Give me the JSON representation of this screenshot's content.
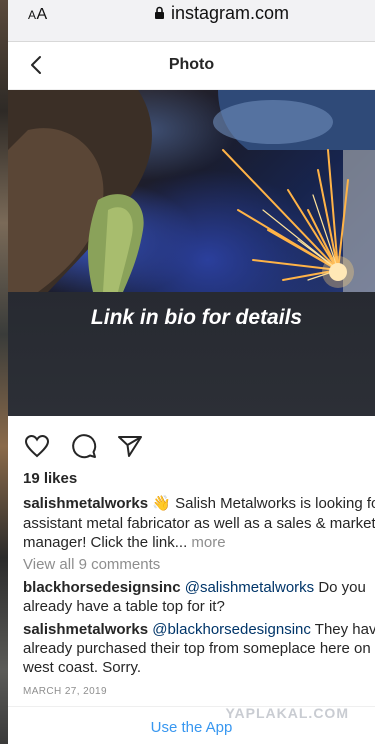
{
  "browser": {
    "text_size_label": "AA",
    "domain": "instagram.com"
  },
  "header": {
    "title": "Photo"
  },
  "photo": {
    "overlay_text": "Link in bio for details"
  },
  "post": {
    "likes": "19 likes",
    "caption": {
      "author": "salishmetalworks",
      "emoji": "👋",
      "line1": "Salish Metalworks is looking fo",
      "line2": "assistant metal fabricator as well as a sales & market",
      "line3": "manager! Click the link...",
      "more": "more"
    },
    "view_all_comments": "View all 9 comments",
    "comments": [
      {
        "author": "blackhorsedesignsinc",
        "mention": "@salishmetalworks",
        "line1": "Do you",
        "line2": "already have a table top for it?"
      },
      {
        "author": "salishmetalworks",
        "mention": "@blackhorsedesignsinc",
        "line1": "They have",
        "line2": "already purchased their top from someplace here on",
        "line3": "west coast. Sorry."
      }
    ],
    "date": "MARCH 27, 2019"
  },
  "footer": {
    "use_app": "Use the App",
    "watermark": "YAPLAKAL.COM"
  },
  "colors": {
    "link_blue": "#3897f0",
    "mention_blue": "#003569",
    "muted_gray": "#8e8e8e"
  }
}
